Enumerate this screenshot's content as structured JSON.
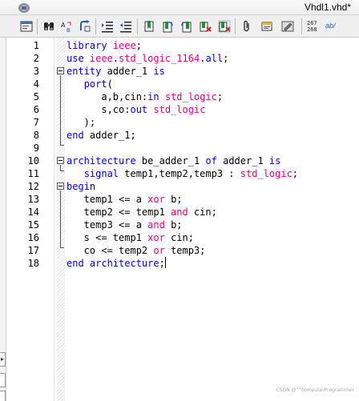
{
  "window": {
    "title": "Vhdl1.vhd*",
    "app_icon": "vhdl-document-icon"
  },
  "toolbar": {
    "buttons": [
      {
        "name": "editor-settings-button",
        "icon": "text-window-icon"
      },
      {
        "name": "find-button",
        "icon": "binoculars-icon"
      },
      {
        "name": "find-replace-button",
        "icon": "find-replace-icon"
      },
      {
        "name": "find-next-button",
        "icon": "find-next-icon"
      },
      {
        "name": "indent-button",
        "icon": "indent-icon"
      },
      {
        "name": "unindent-button",
        "icon": "unindent-icon"
      },
      {
        "name": "toggle-bookmark-button",
        "icon": "bookmark-icon"
      },
      {
        "name": "next-bookmark-button",
        "icon": "bookmark-next-icon"
      },
      {
        "name": "previous-bookmark-button",
        "icon": "bookmark-prev-icon"
      },
      {
        "name": "clear-bookmarks-button",
        "icon": "bookmark-clear-icon"
      },
      {
        "name": "delete-bookmark-button",
        "icon": "bookmark-delete-icon"
      },
      {
        "name": "insert-file-button",
        "icon": "paperclip-icon"
      },
      {
        "name": "insert-template-button",
        "icon": "template-icon"
      },
      {
        "name": "comment-button",
        "icon": "comment-icon"
      }
    ],
    "line_numbers_label_top": "267",
    "line_numbers_label_bottom": "268",
    "ab_label": "ab/"
  },
  "editor": {
    "line_numbers": [
      "1",
      "2",
      "3",
      "4",
      "5",
      "6",
      "7",
      "8",
      "9",
      "10",
      "11",
      "12",
      "13",
      "14",
      "15",
      "16",
      "17",
      "18"
    ],
    "lines": [
      [
        {
          "t": "library ",
          "c": "kw"
        },
        {
          "t": "ieee",
          "c": "type"
        },
        {
          "t": ";",
          "c": ""
        }
      ],
      [
        {
          "t": "use ",
          "c": "kw"
        },
        {
          "t": "ieee",
          "c": "type"
        },
        {
          "t": ".",
          "c": ""
        },
        {
          "t": "std_logic_1164",
          "c": "type"
        },
        {
          "t": ".",
          "c": ""
        },
        {
          "t": "all",
          "c": "kw"
        },
        {
          "t": ";",
          "c": ""
        }
      ],
      [
        {
          "t": "entity ",
          "c": "kw"
        },
        {
          "t": "adder_1 ",
          "c": ""
        },
        {
          "t": "is",
          "c": "kw"
        }
      ],
      [
        {
          "t": "   ",
          "c": ""
        },
        {
          "t": "port",
          "c": "kw"
        },
        {
          "t": "(",
          "c": ""
        }
      ],
      [
        {
          "t": "      a,b,cin:",
          "c": ""
        },
        {
          "t": "in ",
          "c": "kw"
        },
        {
          "t": "std_logic",
          "c": "type"
        },
        {
          "t": ";",
          "c": ""
        }
      ],
      [
        {
          "t": "      s,co:",
          "c": ""
        },
        {
          "t": "out ",
          "c": "kw"
        },
        {
          "t": "std_logic",
          "c": "type"
        }
      ],
      [
        {
          "t": "   );",
          "c": ""
        }
      ],
      [
        {
          "t": "end ",
          "c": "kw"
        },
        {
          "t": "adder_1;",
          "c": ""
        }
      ],
      [],
      [
        {
          "t": "architecture ",
          "c": "kw"
        },
        {
          "t": "be_adder_1 ",
          "c": ""
        },
        {
          "t": "of ",
          "c": "kw"
        },
        {
          "t": "adder_1 ",
          "c": ""
        },
        {
          "t": "is",
          "c": "kw"
        }
      ],
      [
        {
          "t": "   ",
          "c": ""
        },
        {
          "t": "signal ",
          "c": "kw"
        },
        {
          "t": "temp1,temp2,temp3 : ",
          "c": ""
        },
        {
          "t": "std_logic",
          "c": "type"
        },
        {
          "t": ";",
          "c": ""
        }
      ],
      [
        {
          "t": "begin",
          "c": "kw"
        }
      ],
      [
        {
          "t": "   temp1 <= a ",
          "c": ""
        },
        {
          "t": "xor ",
          "c": "type"
        },
        {
          "t": "b;",
          "c": ""
        }
      ],
      [
        {
          "t": "   temp2 <= temp1 ",
          "c": ""
        },
        {
          "t": "and ",
          "c": "type"
        },
        {
          "t": "cin;",
          "c": ""
        }
      ],
      [
        {
          "t": "   temp3 <= a ",
          "c": ""
        },
        {
          "t": "and ",
          "c": "type"
        },
        {
          "t": "b;",
          "c": ""
        }
      ],
      [
        {
          "t": "   s <= temp1 ",
          "c": ""
        },
        {
          "t": "xor ",
          "c": "type"
        },
        {
          "t": "cin;",
          "c": ""
        }
      ],
      [
        {
          "t": "   co <= temp2 ",
          "c": ""
        },
        {
          "t": "or ",
          "c": "type"
        },
        {
          "t": "temp3;",
          "c": ""
        }
      ],
      [
        {
          "t": "end ",
          "c": "kw"
        },
        {
          "t": "architecture",
          "c": "kw"
        },
        {
          "t": ";",
          "c": ""
        }
      ]
    ],
    "caret_line": 18,
    "colors": {
      "keyword": "#0000e6",
      "type": "#e6007a",
      "text": "#000000"
    }
  },
  "watermark": "CSDN @“”computerProgrammer"
}
